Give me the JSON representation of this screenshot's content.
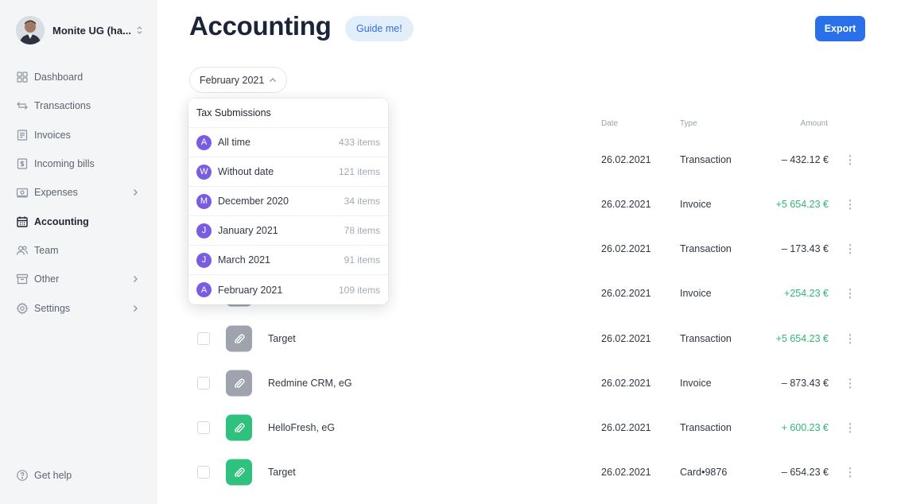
{
  "sidebar": {
    "org_name": "Monite UG (ha...",
    "items": [
      {
        "label": "Dashboard",
        "icon": "grid-icon",
        "chevron": false,
        "active": false
      },
      {
        "label": "Transactions",
        "icon": "transfer-arrows-icon",
        "chevron": false,
        "active": false
      },
      {
        "label": "Invoices",
        "icon": "invoice-icon",
        "chevron": false,
        "active": false
      },
      {
        "label": "Incoming bills",
        "icon": "bill-icon",
        "chevron": false,
        "active": false
      },
      {
        "label": "Expenses",
        "icon": "expenses-icon",
        "chevron": true,
        "active": false
      },
      {
        "label": "Accounting",
        "icon": "calendar-icon",
        "chevron": false,
        "active": true
      },
      {
        "label": "Team",
        "icon": "people-icon",
        "chevron": false,
        "active": false
      },
      {
        "label": "Other",
        "icon": "archive-icon",
        "chevron": true,
        "active": false
      },
      {
        "label": "Settings",
        "icon": "gear-icon",
        "chevron": true,
        "active": false
      }
    ],
    "help_label": "Get help"
  },
  "header": {
    "title": "Accounting",
    "guide_label": "Guide me!",
    "export_label": "Export",
    "period_label": "February 2021"
  },
  "table": {
    "columns": {
      "date": "Date",
      "type": "Type",
      "amount": "Amount"
    },
    "rows": [
      {
        "name": "",
        "date": "26.02.2021",
        "type": "Transaction",
        "amount": "– 432.12 €",
        "positive": false,
        "attachment": ""
      },
      {
        "name": "",
        "date": "26.02.2021",
        "type": "Invoice",
        "amount": "+5 654.23 €",
        "positive": true,
        "attachment": ""
      },
      {
        "name": "",
        "date": "26.02.2021",
        "type": "Transaction",
        "amount": "– 173.43 €",
        "positive": false,
        "attachment": ""
      },
      {
        "name": "",
        "date": "26.02.2021",
        "type": "Invoice",
        "amount": "+254.23 €",
        "positive": true,
        "attachment": ""
      },
      {
        "name": "Target",
        "date": "26.02.2021",
        "type": "Transaction",
        "amount": "+5 654.23 €",
        "positive": true,
        "attachment": "gray"
      },
      {
        "name": "Redmine CRM, eG",
        "date": "26.02.2021",
        "type": "Invoice",
        "amount": "– 873.43 €",
        "positive": false,
        "attachment": "gray"
      },
      {
        "name": "HelloFresh, eG",
        "date": "26.02.2021",
        "type": "Transaction",
        "amount": "+ 600.23 €",
        "positive": true,
        "attachment": "green"
      },
      {
        "name": "Target",
        "date": "26.02.2021",
        "type": "Card•9876",
        "amount": "– 654.23 €",
        "positive": false,
        "attachment": "green"
      }
    ]
  },
  "dropdown": {
    "header": "Tax Submissions",
    "items": [
      {
        "letter": "A",
        "label": "All time",
        "count": "433 items"
      },
      {
        "letter": "W",
        "label": "Without date",
        "count": "121 items"
      },
      {
        "letter": "M",
        "label": "December 2020",
        "count": "34 items"
      },
      {
        "letter": "J",
        "label": "January 2021",
        "count": "78 items"
      },
      {
        "letter": "J",
        "label": "March 2021",
        "count": "91 items"
      },
      {
        "letter": "A",
        "label": "February 2021",
        "count": "109 items"
      }
    ]
  },
  "colors": {
    "accent": "#2a70ea",
    "positive": "#2eb872",
    "letter_badge": "#7a5ce0",
    "attachment_gray": "#9ea3ad",
    "attachment_green": "#2ec27e"
  }
}
